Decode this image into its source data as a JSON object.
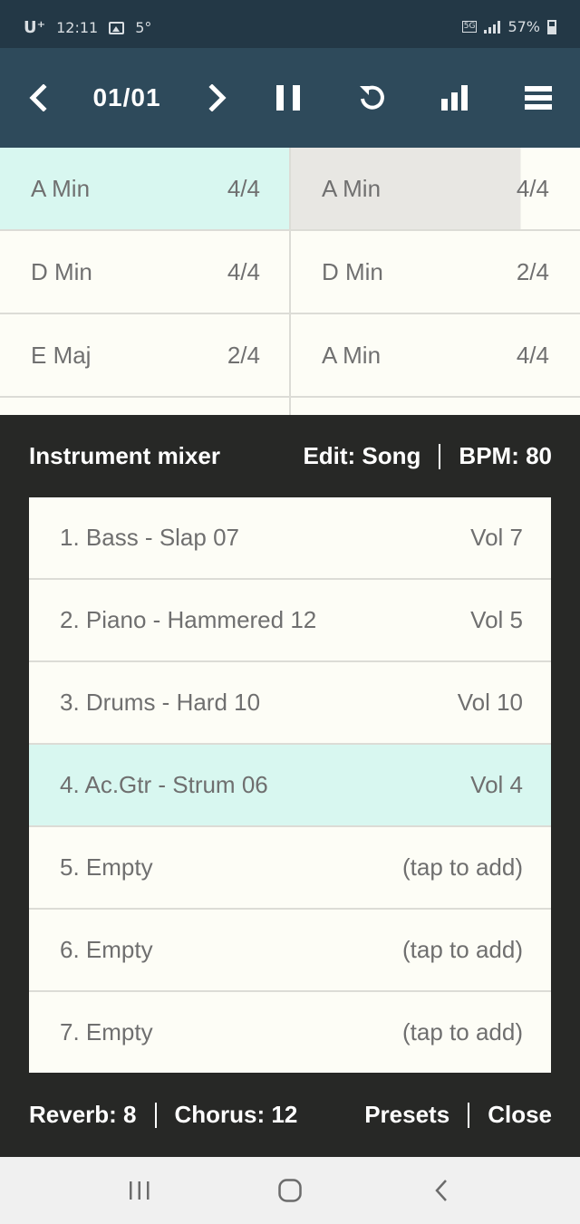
{
  "status_bar": {
    "carrier": "U⁺",
    "time": "12:11",
    "temperature": "5°",
    "network": "5G",
    "battery": "57%"
  },
  "toolbar": {
    "counter": "01/01"
  },
  "chord_grid": [
    [
      {
        "chord": "A Min",
        "beats": "4/4",
        "highlight": true
      },
      {
        "chord": "A Min",
        "beats": "4/4",
        "progress": 0.8
      }
    ],
    [
      {
        "chord": "D Min",
        "beats": "4/4"
      },
      {
        "chord": "D Min",
        "beats": "2/4"
      }
    ],
    [
      {
        "chord": "E Maj",
        "beats": "2/4"
      },
      {
        "chord": "A Min",
        "beats": "4/4"
      }
    ]
  ],
  "mixer": {
    "title": "Instrument mixer",
    "edit": "Edit: Song",
    "bpm": "BPM: 80",
    "tracks": [
      {
        "name": "1. Bass - Slap 07",
        "value": "Vol 7"
      },
      {
        "name": "2. Piano - Hammered 12",
        "value": "Vol 5"
      },
      {
        "name": "3. Drums - Hard 10",
        "value": "Vol 10"
      },
      {
        "name": "4. Ac.Gtr - Strum 06",
        "value": "Vol 4",
        "selected": true
      },
      {
        "name": "5. Empty",
        "value": "(tap to add)"
      },
      {
        "name": "6. Empty",
        "value": "(tap to add)"
      },
      {
        "name": "7. Empty",
        "value": "(tap to add)"
      }
    ],
    "reverb": "Reverb: 8",
    "chorus": "Chorus: 12",
    "presets": "Presets",
    "close": "Close"
  },
  "colors": {
    "toolbar": "#2e4a5b",
    "statusbar": "#233846",
    "highlight": "#d8f7f0",
    "panel": "#272826"
  }
}
